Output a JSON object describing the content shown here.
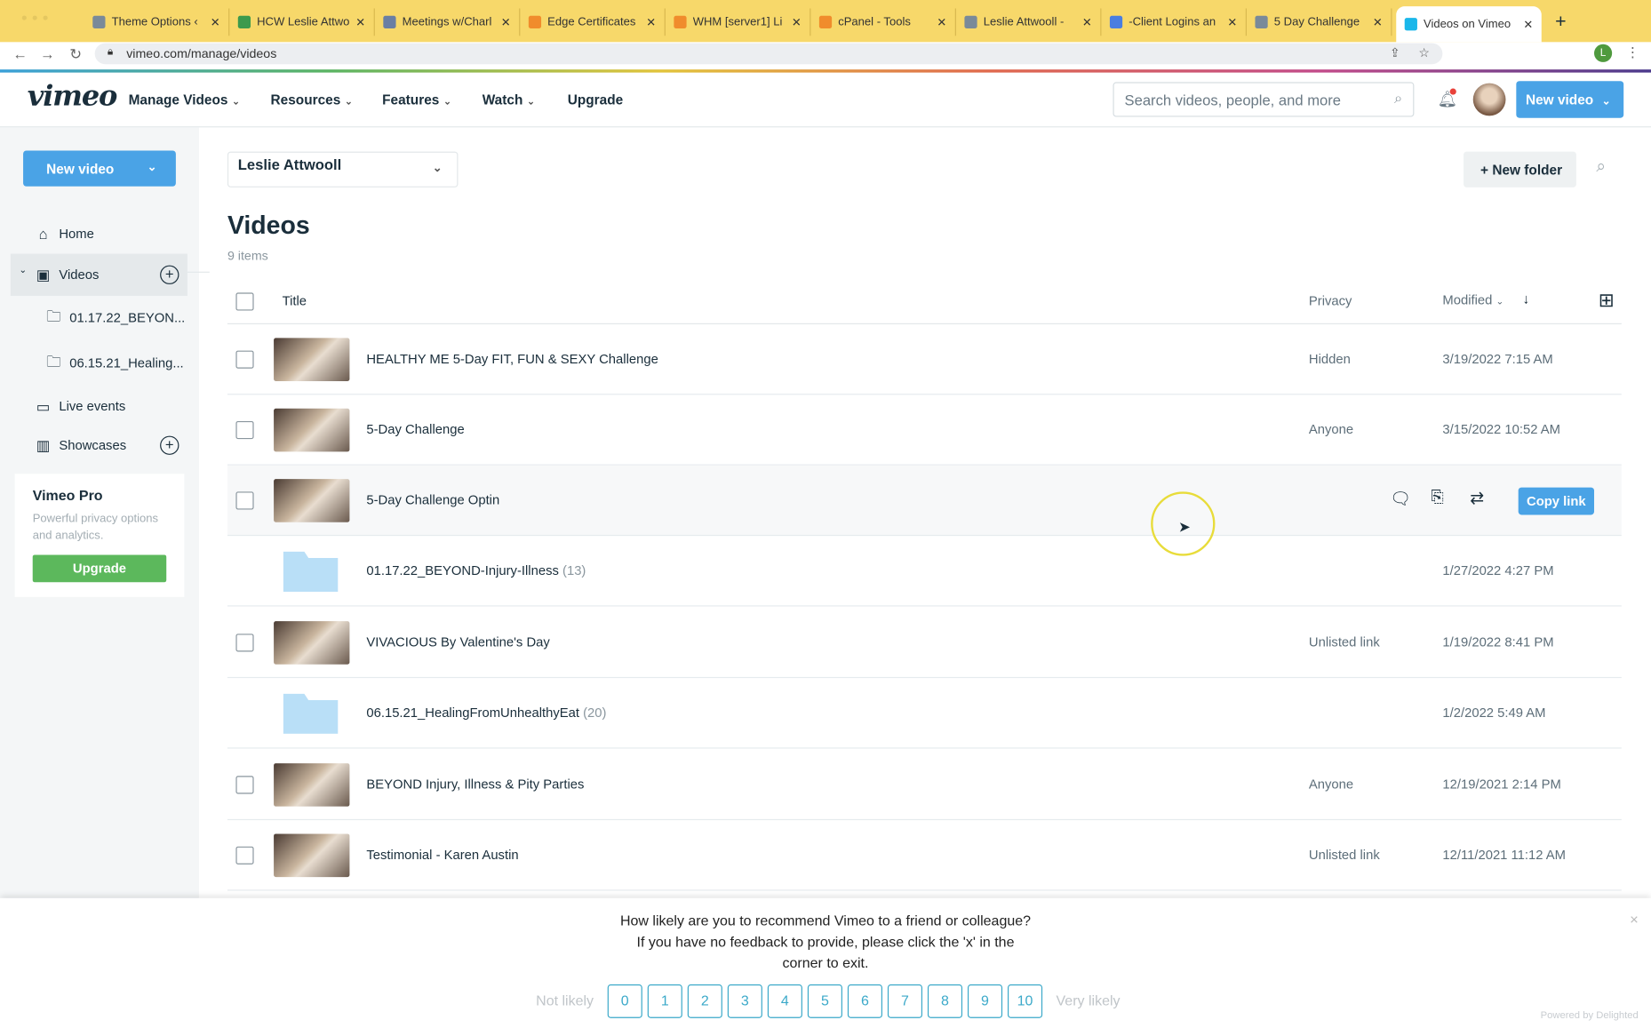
{
  "browser": {
    "tabs": [
      {
        "label": "Theme Options ‹"
      },
      {
        "label": "HCW Leslie Attwo"
      },
      {
        "label": "Meetings w/Charl"
      },
      {
        "label": "Edge Certificates"
      },
      {
        "label": "WHM [server1] Li"
      },
      {
        "label": "cPanel - Tools"
      },
      {
        "label": "Leslie Attwooll - "
      },
      {
        "label": "-Client Logins an"
      },
      {
        "label": "5 Day Challenge"
      },
      {
        "label": "Videos on Vimeo"
      }
    ],
    "url": "vimeo.com/manage/videos",
    "profile_initial": "L"
  },
  "header": {
    "logo": "vimeo",
    "nav": [
      "Manage Videos",
      "Resources",
      "Features",
      "Watch",
      "Upgrade"
    ],
    "search_placeholder": "Search videos, people, and more",
    "new_video": "New video"
  },
  "sidebar": {
    "new_video": "New video",
    "items": [
      {
        "label": "Home"
      },
      {
        "label": "Videos"
      },
      {
        "label": "01.17.22_BEYON..."
      },
      {
        "label": "06.15.21_Healing..."
      },
      {
        "label": "Live events"
      },
      {
        "label": "Showcases"
      }
    ],
    "promo": {
      "title": "Vimeo Pro",
      "text": "Powerful privacy options and analytics.",
      "button": "Upgrade"
    }
  },
  "main": {
    "account": "Leslie Attwooll",
    "new_folder": "New folder",
    "title": "Videos",
    "count": "9 items",
    "columns": {
      "title": "Title",
      "privacy": "Privacy",
      "modified": "Modified"
    },
    "copy_link": "Copy link",
    "rows": [
      {
        "type": "video",
        "title": "HEALTHY ME 5-Day FIT, FUN & SEXY Challenge",
        "privacy": "Hidden",
        "modified": "3/19/2022 7:15 AM"
      },
      {
        "type": "video",
        "title": "5-Day Challenge",
        "privacy": "Anyone",
        "modified": "3/15/2022 10:52 AM"
      },
      {
        "type": "video",
        "title": "5-Day Challenge Optin",
        "privacy": "",
        "modified": ""
      },
      {
        "type": "folder",
        "title": "01.17.22_BEYOND-Injury-Illness",
        "count": "(13)",
        "privacy": "",
        "modified": "1/27/2022 4:27 PM"
      },
      {
        "type": "video",
        "title": "VIVACIOUS By Valentine's Day",
        "privacy": "Unlisted link",
        "modified": "1/19/2022 8:41 PM"
      },
      {
        "type": "folder",
        "title": "06.15.21_HealingFromUnhealthyEat",
        "count": "(20)",
        "privacy": "",
        "modified": "1/2/2022 5:49 AM"
      },
      {
        "type": "video",
        "title": "BEYOND Injury, Illness & Pity Parties",
        "privacy": "Anyone",
        "modified": "12/19/2021 2:14 PM"
      },
      {
        "type": "video",
        "title": "Testimonial - Karen Austin",
        "privacy": "Unlisted link",
        "modified": "12/11/2021 11:12 AM"
      }
    ]
  },
  "survey": {
    "line1": "How likely are you to recommend Vimeo to a friend or colleague?",
    "line2": "If you have no feedback to provide, please click the 'x' in the",
    "line3": "corner to exit.",
    "not_likely": "Not likely",
    "very_likely": "Very likely",
    "scores": [
      "0",
      "1",
      "2",
      "3",
      "4",
      "5",
      "6",
      "7",
      "8",
      "9",
      "10"
    ],
    "powered": "Powered by Delighted",
    "close": "×"
  },
  "colors": {
    "accent": "#4aa3e6",
    "upgrade": "#5cb85c",
    "tabbar": "#f7d86a",
    "survey": "#3ba9c9"
  }
}
